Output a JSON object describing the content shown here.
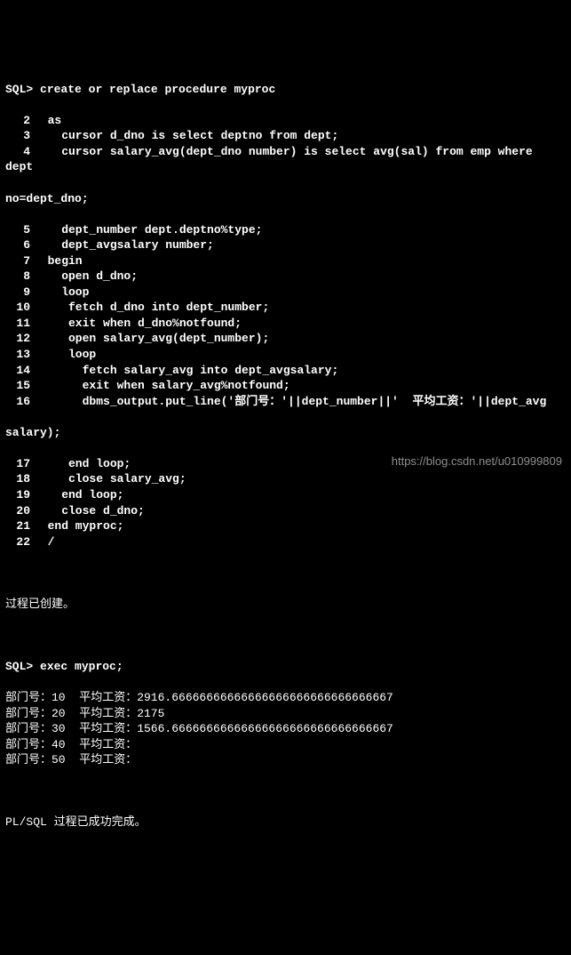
{
  "prompts": {
    "sql": "SQL>",
    "create_cmd": "create or replace procedure myproc",
    "exec_cmd": "exec myproc;"
  },
  "code_lines": [
    {
      "n": "2",
      "t": " as"
    },
    {
      "n": "3",
      "t": "   cursor d_dno is select deptno from dept;"
    },
    {
      "n": "4",
      "t": "   cursor salary_avg(dept_dno number) is select avg(sal) from emp where dept"
    }
  ],
  "wrap_line_4": "no=dept_dno;",
  "code_lines2": [
    {
      "n": "5",
      "t": "   dept_number dept.deptno%type;"
    },
    {
      "n": "6",
      "t": "   dept_avgsalary number;"
    },
    {
      "n": "7",
      "t": " begin"
    },
    {
      "n": "8",
      "t": "   open d_dno;"
    },
    {
      "n": "9",
      "t": "   loop"
    },
    {
      "n": "10",
      "t": "    fetch d_dno into dept_number;"
    },
    {
      "n": "11",
      "t": "    exit when d_dno%notfound;"
    },
    {
      "n": "12",
      "t": "    open salary_avg(dept_number);"
    },
    {
      "n": "13",
      "t": "    loop"
    },
    {
      "n": "14",
      "t": "      fetch salary_avg into dept_avgsalary;"
    },
    {
      "n": "15",
      "t": "      exit when salary_avg%notfound;"
    },
    {
      "n": "16",
      "t": "      dbms_output.put_line('部门号：'||dept_number||'  平均工资：'||dept_avg"
    }
  ],
  "wrap_line_16": "salary);",
  "code_lines3": [
    {
      "n": "17",
      "t": "    end loop;"
    },
    {
      "n": "18",
      "t": "    close salary_avg;"
    },
    {
      "n": "19",
      "t": "   end loop;"
    },
    {
      "n": "20",
      "t": "   close d_dno;"
    },
    {
      "n": "21",
      "t": " end myproc;"
    },
    {
      "n": "22",
      "t": " /"
    }
  ],
  "messages": {
    "created": "过程已创建。",
    "completed": "PL/SQL 过程已成功完成。"
  },
  "output": [
    "部门号：10  平均工资：2916.66666666666666666666666666666667",
    "部门号：20  平均工资：2175",
    "部门号：30  平均工资：1566.66666666666666666666666666666667",
    "部门号：40  平均工资：",
    "部门号：50  平均工资："
  ],
  "watermark": "https://blog.csdn.net/u010999809"
}
